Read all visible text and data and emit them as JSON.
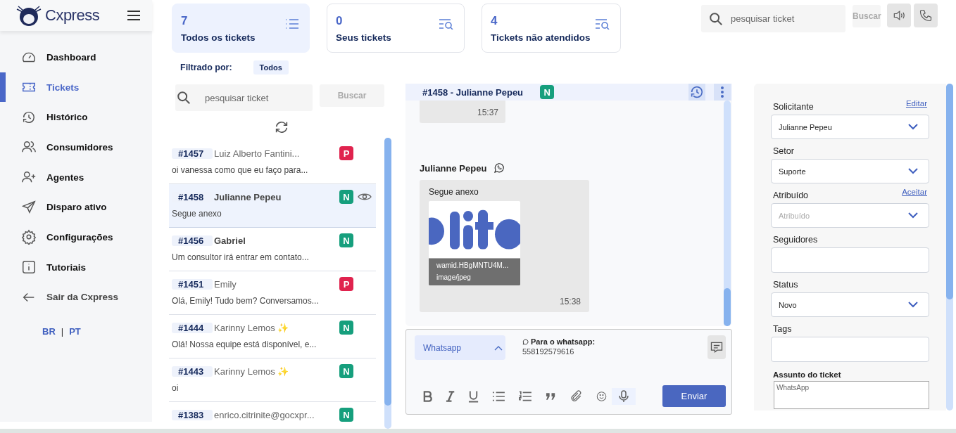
{
  "brand": {
    "name": "Cxpress"
  },
  "nav": [
    {
      "label": "Dashboard",
      "selected": false
    },
    {
      "label": "Tickets",
      "selected": true
    },
    {
      "label": "Histórico",
      "selected": false
    },
    {
      "label": "Consumidores",
      "selected": false
    },
    {
      "label": "Agentes",
      "selected": false
    },
    {
      "label": "Disparo ativo",
      "selected": false
    },
    {
      "label": "Configurações",
      "selected": false
    },
    {
      "label": "Tutoriais",
      "selected": false
    }
  ],
  "logout": {
    "label": "Sair da Cxpress"
  },
  "languages": [
    "BR",
    "|",
    "PT"
  ],
  "stats": [
    {
      "count": "7",
      "label": "Todos os tickets",
      "selected": true
    },
    {
      "count": "0",
      "label": "Seus tickets",
      "selected": false
    },
    {
      "count": "4",
      "label": "Tickets não atendidos",
      "selected": false
    }
  ],
  "top_search": {
    "placeholder": "pesquisar ticket",
    "button": "Buscar"
  },
  "filter": {
    "label": "Filtrado por:",
    "value": "Todos"
  },
  "list_search": {
    "placeholder": "pesquisar ticket",
    "button": "Buscar"
  },
  "tickets": [
    {
      "id": "#1457",
      "name": "Luiz Alberto Fantini...",
      "preview": "oi vanessa como que eu faço para...",
      "status": "P",
      "color": "#e0234e",
      "unread": false,
      "selected": false
    },
    {
      "id": "#1458",
      "name": "Julianne Pepeu",
      "preview": "Segue anexo",
      "status": "N",
      "color": "#169f7d",
      "unread": true,
      "selected": true
    },
    {
      "id": "#1456",
      "name": "Gabriel",
      "preview": "Um consultor irá entrar em contato...",
      "status": "N",
      "color": "#169f7d",
      "unread": true,
      "selected": false
    },
    {
      "id": "#1451",
      "name": "Emily",
      "preview": "Olá, Emily! Tudo bem? Conversamos...",
      "status": "P",
      "color": "#e0234e",
      "unread": false,
      "selected": false
    },
    {
      "id": "#1444",
      "name": "Karinny Lemos ✨",
      "preview": "Olá! Nossa equipe está disponível, e...",
      "status": "N",
      "color": "#169f7d",
      "unread": false,
      "selected": false
    },
    {
      "id": "#1443",
      "name": "Karinny Lemos ✨",
      "preview": "oi",
      "status": "N",
      "color": "#169f7d",
      "unread": false,
      "selected": false
    },
    {
      "id": "#1383",
      "name": "enrico.citrinite@gocxpr...",
      "status": "N",
      "color": "#169f7d",
      "unread": false,
      "selected": false
    }
  ],
  "chat": {
    "title": "#1458 - Julianne Pepeu",
    "status": "N",
    "color": "#169f7d",
    "messages": [
      {
        "kind": "time",
        "time": "15:37"
      },
      {
        "kind": "attachment",
        "sender": "Julianne Pepeu",
        "text": "Segue anexo",
        "file_name": "wamid.HBgMNTU4M...",
        "file_type": "image/jpeg",
        "time": "15:38"
      }
    ]
  },
  "composer": {
    "channel": "Whatsapp",
    "to_label": "Para o whatsapp:",
    "to_number": "558192579616",
    "send": "Enviar"
  },
  "details": [
    {
      "label": "Solicitante",
      "action": "Editar",
      "kind": "select",
      "value": "Julianne Pepeu"
    },
    {
      "label": "Setor",
      "kind": "select",
      "value": "Suporte"
    },
    {
      "label": "Atribuído",
      "action": "Aceitar",
      "kind": "select",
      "placeholder": "Atribuído"
    },
    {
      "label": "Seguidores",
      "kind": "input"
    },
    {
      "label": "Status",
      "kind": "select",
      "value": "Novo"
    },
    {
      "label": "Tags",
      "kind": "input"
    }
  ],
  "subject": {
    "label": "Assunto do ticket",
    "value": "WhatsApp"
  }
}
